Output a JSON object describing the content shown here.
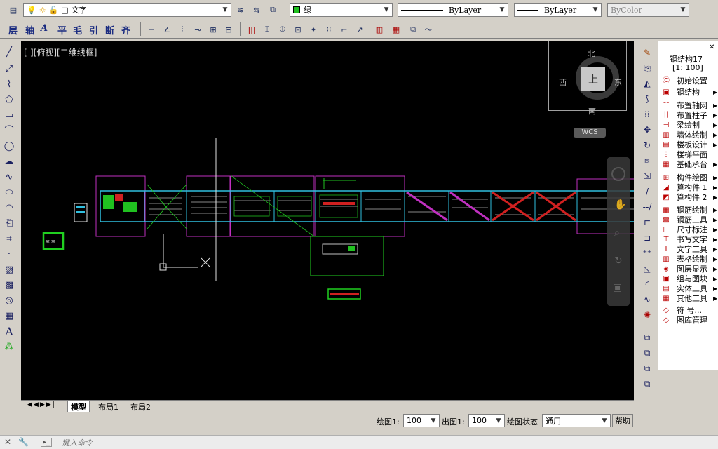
{
  "toolbar1": {
    "layer_name": "文字",
    "color_value": "绿",
    "linetype_value": "ByLayer",
    "lineweight_value": "ByLayer",
    "plotstyle_value": "ByColor"
  },
  "toolbar2": {
    "text_buttons": [
      "层",
      "轴",
      "平",
      "毛",
      "引",
      "断",
      "齐"
    ]
  },
  "viewport": {
    "label": "[-][俯视][二维线框]",
    "viewcube_top": "上",
    "compass_n": "北",
    "compass_s": "南",
    "compass_e": "东",
    "compass_w": "西",
    "wcs": "WCS"
  },
  "tabs": [
    "模型",
    "布局1",
    "布局2"
  ],
  "statusbar": {
    "draw_scale_label": "绘图1:",
    "draw_scale_value": "100",
    "out_scale_label": "出图1:",
    "out_scale_value": "100",
    "state_label": "绘图状态",
    "state_value": "通用",
    "help_label": "帮助"
  },
  "command": {
    "placeholder": "键入命令"
  },
  "side_menu": {
    "title": "钢结构17",
    "scale": "[1: 100]",
    "items": [
      {
        "label": "初始设置",
        "submenu": false
      },
      {
        "label": "钢结构",
        "submenu": true
      },
      {
        "label": "布置轴网",
        "submenu": true
      },
      {
        "label": "布置柱子",
        "submenu": true
      },
      {
        "label": "梁绘制",
        "submenu": true
      },
      {
        "label": "墙体绘制",
        "submenu": true
      },
      {
        "label": "楼板设计",
        "submenu": true
      },
      {
        "label": "楼梯平面",
        "submenu": false
      },
      {
        "label": "基础承台",
        "submenu": true
      },
      {
        "label": "构件绘图",
        "submenu": true
      },
      {
        "label": "算构件 1",
        "submenu": true
      },
      {
        "label": "算构件 2",
        "submenu": true
      },
      {
        "label": "钢筋绘制",
        "submenu": true
      },
      {
        "label": "钢筋工具",
        "submenu": true
      },
      {
        "label": "尺寸标注",
        "submenu": true
      },
      {
        "label": "书写文字",
        "submenu": true
      },
      {
        "label": "文字工具",
        "submenu": true
      },
      {
        "label": "表格绘制",
        "submenu": true
      },
      {
        "label": "图层显示",
        "submenu": true
      },
      {
        "label": "组与图块",
        "submenu": true
      },
      {
        "label": "实体工具",
        "submenu": true
      },
      {
        "label": "其他工具",
        "submenu": true
      },
      {
        "label": "符 号...",
        "submenu": false
      },
      {
        "label": "图库管理",
        "submenu": false
      }
    ]
  },
  "colors": {
    "canvas_bg": "#000000",
    "frame_magenta": "#c030c0",
    "frame_green": "#20d020",
    "sheet_cyan": "#30c0e0",
    "cross_red": "#d02020"
  }
}
